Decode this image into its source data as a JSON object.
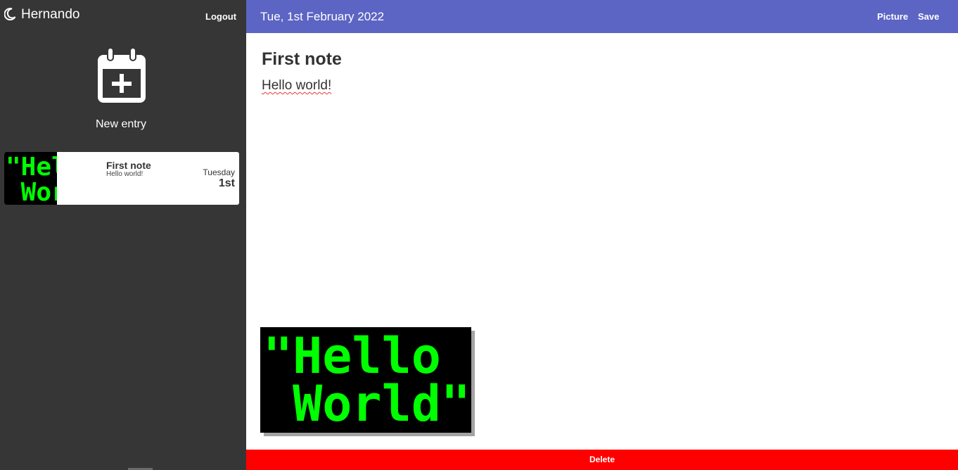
{
  "sidebar": {
    "user_name": "Hernando",
    "logout_label": "Logout",
    "new_entry_label": "New entry",
    "entries": [
      {
        "title": "First note",
        "preview": "Hello world!",
        "day": "Tuesday",
        "date": "1st",
        "thumbnail_text_line1": "\"Hello",
        "thumbnail_text_line2": " World\""
      }
    ]
  },
  "topbar": {
    "date": "Tue, 1st February 2022",
    "picture_label": "Picture",
    "save_label": "Save"
  },
  "note": {
    "title": "First note",
    "body": "Hello world!",
    "picture_text_line1": "\"Hello",
    "picture_text_line2": " World\""
  },
  "footer": {
    "delete_label": "Delete"
  },
  "colors": {
    "sidebar_bg": "#363636",
    "topbar_bg": "#5c64c4",
    "delete_bg": "#ff0000",
    "picture_text": "#00ff00"
  },
  "icons": {
    "theme_toggle": "moon-icon",
    "new_entry": "calendar-plus-icon"
  }
}
